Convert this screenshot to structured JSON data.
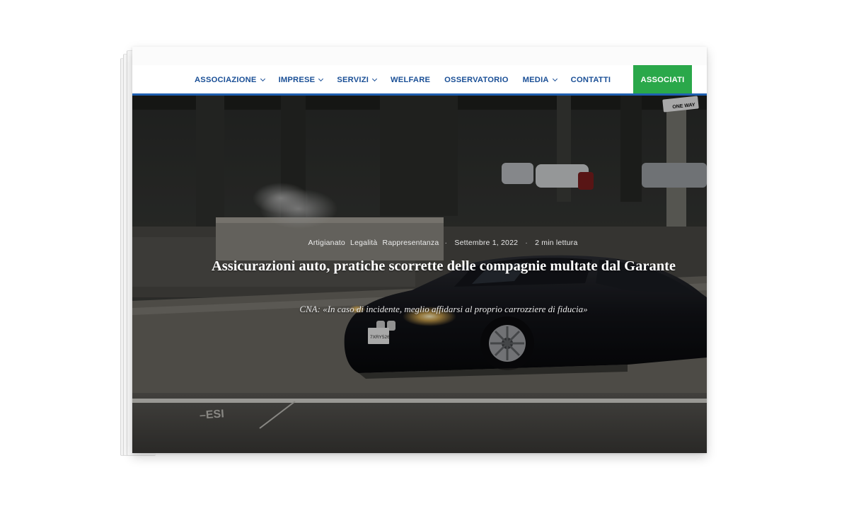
{
  "nav": {
    "items": [
      {
        "label": "ASSOCIAZIONE",
        "dropdown": true
      },
      {
        "label": "IMPRESE",
        "dropdown": true
      },
      {
        "label": "SERVIZI",
        "dropdown": true
      },
      {
        "label": "WELFARE",
        "dropdown": false
      },
      {
        "label": "OSSERVATORIO",
        "dropdown": false
      },
      {
        "label": "MEDIA",
        "dropdown": true
      },
      {
        "label": "CONTATTI",
        "dropdown": false
      }
    ],
    "cta": "ASSOCIATI"
  },
  "article": {
    "categories": [
      "Artigianato",
      "Legalità",
      "Rappresentanza"
    ],
    "date": "Settembre 1, 2022",
    "read_time": "2 min lettura",
    "title": "Assicurazioni auto, pratiche scorrette delle compagnie multate dal Garante",
    "subtitle": "CNA: «In caso di incidente, meglio affidarsi al proprio carrozziere di fiducia»"
  },
  "hero_image": {
    "street_sign": "ONE WAY",
    "road_marking": "–ESI",
    "plate": "7XRY526"
  },
  "colors": {
    "nav_text": "#1a4f96",
    "nav_line": "#1f5fb0",
    "cta_bg": "#2aa84a"
  }
}
